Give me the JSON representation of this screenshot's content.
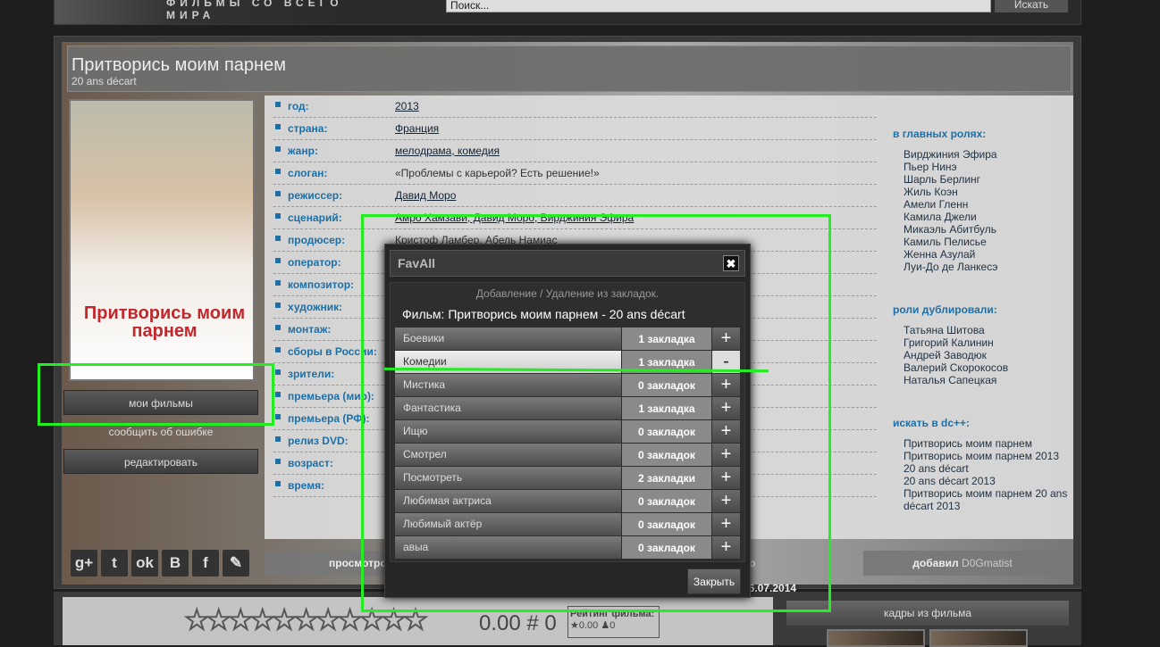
{
  "header": {
    "tagline": "ФИЛЬМЫ СО ВСЕГО МИРА",
    "search_placeholder": "Поиск...",
    "search_button": "Искать"
  },
  "film": {
    "title": "Притворись моим парнем",
    "subtitle": "20 ans décart",
    "poster_title": "Притворись моим парнем"
  },
  "left_buttons": {
    "my_films": "мои фильмы",
    "report": "сообщить об ошибке",
    "edit": "редактировать"
  },
  "info": [
    {
      "k": "год:",
      "v": "2013",
      "link": true
    },
    {
      "k": "страна:",
      "v": "Франция",
      "link": true
    },
    {
      "k": "жанр:",
      "v": "мелодрама, комедия",
      "link": true
    },
    {
      "k": "слоган:",
      "v": "«Проблемы с карьерой? Есть решение!»",
      "link": false
    },
    {
      "k": "режиссер:",
      "v": "Давид Моро",
      "link": true
    },
    {
      "k": "сценарий:",
      "v": "Амро Хамзави, Давид Моро, Вирджиния Эфира",
      "link": true
    },
    {
      "k": "продюсер:",
      "v": "Кристоф Ламбер, Абель Намиас",
      "link": false
    },
    {
      "k": "оператор:",
      "v": "",
      "link": false
    },
    {
      "k": "композитор:",
      "v": "",
      "link": false
    },
    {
      "k": "художник:",
      "v": "",
      "link": false
    },
    {
      "k": "монтаж:",
      "v": "",
      "link": false
    },
    {
      "k": "сборы в России:",
      "v": "",
      "link": false
    },
    {
      "k": "зрители:",
      "v": "",
      "link": false
    },
    {
      "k": "премьера (мир):",
      "v": "",
      "link": false
    },
    {
      "k": "премьера (РФ):",
      "v": "",
      "link": false
    },
    {
      "k": "релиз DVD:",
      "v": "",
      "link": false
    },
    {
      "k": "возраст:",
      "v": "",
      "link": false
    },
    {
      "k": "время:",
      "v": "",
      "link": false
    }
  ],
  "cast": {
    "title": "в главных ролях:",
    "items": [
      "Вирджиния Эфира",
      "Пьер Нинэ",
      "Шарль Берлинг",
      "Жиль Коэн",
      "Амели Гленн",
      "Камила Джели",
      "Микаэль Абитбуль",
      "Камиль Пелисье",
      "Женна Азулай",
      "Луи-До де Ланкесэ"
    ]
  },
  "dub": {
    "title": "роли дублировали:",
    "items": [
      "Татьяна Шитова",
      "Григорий Калинин",
      "Андрей Заводюк",
      "Валерий Скорокосов",
      "Наталья Сапецкая"
    ]
  },
  "dc": {
    "title": "искать в dc++:",
    "items": [
      "Притворись моим парнем",
      "Притворись моим парнем 2013",
      "20 ans décart",
      "20 ans décart 2013",
      "Притворись моим парнем 20 ans décart 2013"
    ]
  },
  "social": [
    "g+",
    "t",
    "ok",
    "B",
    "f",
    "✎"
  ],
  "stats": {
    "views": "просмотро",
    "date": "но 26.07.2014",
    "added_by": "добавил",
    "user": "D0Gmatist"
  },
  "rating": {
    "score": "0.00 # 0",
    "box_title": "Рейтинг фильма:",
    "avg": "0.00",
    "votes": "0"
  },
  "frames": {
    "title": "кадры из фильма"
  },
  "modal": {
    "title": "FavAll",
    "close": "✖",
    "note": "Добавление / Удаление из закладок.",
    "film": "Фильм: Притворись моим парнем - 20 ans décart",
    "close_button": "Закрыть",
    "rows": [
      {
        "name": "Боевики",
        "count": "1 закладка",
        "action": "+"
      },
      {
        "name": "Комедии",
        "count": "1 закладка",
        "action": "-"
      },
      {
        "name": "Мистика",
        "count": "0 закладок",
        "action": "+"
      },
      {
        "name": "Фантастика",
        "count": "1 закладка",
        "action": "+"
      },
      {
        "name": "Ищю",
        "count": "0 закладок",
        "action": "+"
      },
      {
        "name": "Смотрел",
        "count": "0 закладок",
        "action": "+"
      },
      {
        "name": "Посмотреть",
        "count": "2 закладки",
        "action": "+"
      },
      {
        "name": "Любимая актриса",
        "count": "0 закладок",
        "action": "+"
      },
      {
        "name": "Любимый актёр",
        "count": "0 закладок",
        "action": "+"
      },
      {
        "name": "авыа",
        "count": "0 закладок",
        "action": "+"
      }
    ]
  }
}
